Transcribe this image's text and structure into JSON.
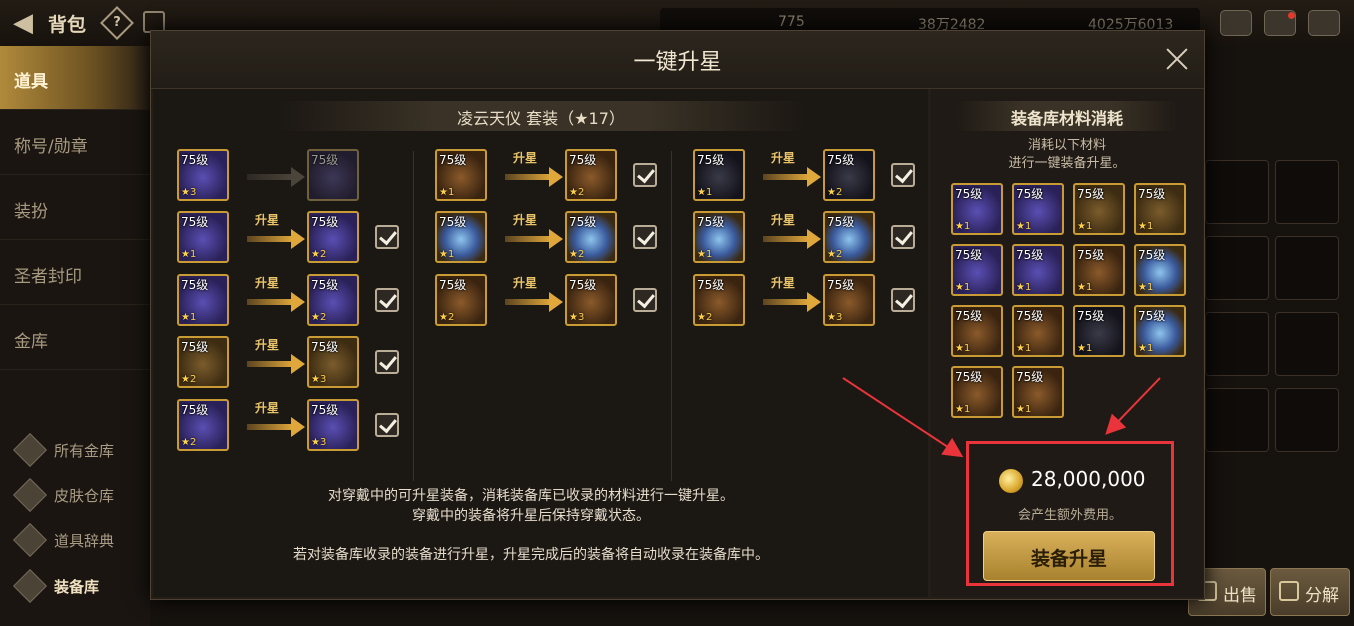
{
  "topbar": {
    "title": "背包",
    "help_label": "?",
    "currency_1": "775",
    "currency_2": "38万2482",
    "currency_3": "4025万6013"
  },
  "sidebar": {
    "tabs": [
      {
        "label": "道具",
        "active": true
      },
      {
        "label": "称号/勋章",
        "active": false
      },
      {
        "label": "装扮",
        "active": false
      },
      {
        "label": "圣者封印",
        "active": false
      },
      {
        "label": "金库",
        "active": false
      }
    ],
    "links": [
      {
        "label": "所有金库",
        "icon": "vault-icon",
        "active": false
      },
      {
        "label": "皮肤仓库",
        "icon": "skin-icon",
        "active": false
      },
      {
        "label": "道具辞典",
        "icon": "dictionary-icon",
        "active": false
      },
      {
        "label": "装备库",
        "icon": "armory-icon",
        "active": true
      }
    ]
  },
  "bottom_buttons": {
    "sell": "出售",
    "disassemble": "分解"
  },
  "modal": {
    "title": "一键升星",
    "set_title": "凌云天仪  套装（★17）",
    "upgrade_arrow_label": "升星",
    "upgrades": [
      {
        "slot": "top",
        "icon": "robe-top-icon",
        "from_level": "75级",
        "from_star": "3",
        "to_level": "75级",
        "to_star": "",
        "available": false
      },
      {
        "slot": "robe",
        "icon": "robe-icon",
        "from_level": "75级",
        "from_star": "1",
        "to_level": "75级",
        "to_star": "2",
        "available": true
      },
      {
        "slot": "pants",
        "icon": "pants-icon",
        "from_level": "75级",
        "from_star": "1",
        "to_level": "75级",
        "to_star": "2",
        "available": true
      },
      {
        "slot": "belt",
        "icon": "belt-icon",
        "from_level": "75级",
        "from_star": "2",
        "to_level": "75级",
        "to_star": "3",
        "available": true
      },
      {
        "slot": "shoes",
        "icon": "shoes-icon",
        "from_level": "75级",
        "from_star": "2",
        "to_level": "75级",
        "to_star": "3",
        "available": true
      },
      {
        "slot": "bracelet",
        "icon": "bracelet-icon",
        "from_level": "75级",
        "from_star": "1",
        "to_level": "75级",
        "to_star": "2",
        "available": true
      },
      {
        "slot": "necklace",
        "icon": "necklace-icon",
        "from_level": "75级",
        "from_star": "1",
        "to_level": "75级",
        "to_star": "2",
        "available": true
      },
      {
        "slot": "ring",
        "icon": "ring-icon",
        "from_level": "75级",
        "from_star": "2",
        "to_level": "75级",
        "to_star": "3",
        "available": true
      },
      {
        "slot": "sub",
        "icon": "sub-equip-icon",
        "from_level": "75级",
        "from_star": "1",
        "to_level": "75级",
        "to_star": "2",
        "available": true
      },
      {
        "slot": "magic-stone",
        "icon": "magic-stone-icon",
        "from_level": "75级",
        "from_star": "1",
        "to_level": "75级",
        "to_star": "2",
        "available": true
      },
      {
        "slot": "earring",
        "icon": "earring-icon",
        "from_level": "75级",
        "from_star": "2",
        "to_level": "75级",
        "to_star": "3",
        "available": true
      }
    ],
    "info_line1": "对穿戴中的可升星装备，消耗装备库已收录的材料进行一键升星。",
    "info_line2": "穿戴中的装备将升星后保持穿戴状态。",
    "info_line3": "若对装备库收录的装备进行升星，升星完成后的装备将自动收录在装备库中。",
    "materials_title": "装备库材料消耗",
    "materials_desc1": "消耗以下材料",
    "materials_desc2": "进行一键装备升星。",
    "materials": [
      {
        "level": "75级",
        "star": "1",
        "icon": "robe-icon"
      },
      {
        "level": "75级",
        "star": "1",
        "icon": "pants-icon"
      },
      {
        "level": "75级",
        "star": "1",
        "icon": "belt-icon"
      },
      {
        "level": "75级",
        "star": "1",
        "icon": "belt-icon"
      },
      {
        "level": "75级",
        "star": "1",
        "icon": "pants-icon"
      },
      {
        "level": "75级",
        "star": "1",
        "icon": "shoes-icon"
      },
      {
        "level": "75级",
        "star": "1",
        "icon": "bracelet-icon"
      },
      {
        "level": "75级",
        "star": "1",
        "icon": "necklace-icon"
      },
      {
        "level": "75级",
        "star": "1",
        "icon": "ring-icon"
      },
      {
        "level": "75级",
        "star": "1",
        "icon": "ring-icon"
      },
      {
        "level": "75级",
        "star": "1",
        "icon": "sub-equip-icon"
      },
      {
        "level": "75级",
        "star": "1",
        "icon": "magic-stone-icon"
      },
      {
        "level": "75级",
        "star": "1",
        "icon": "earring-icon"
      },
      {
        "level": "75级",
        "star": "1",
        "icon": "earring-icon"
      }
    ],
    "cost": "28,000,000",
    "cost_note": "会产生额外费用。",
    "upgrade_button": "装备升星"
  },
  "colors": {
    "highlight": "#e8343a",
    "accent_gold": "#c99b35"
  }
}
